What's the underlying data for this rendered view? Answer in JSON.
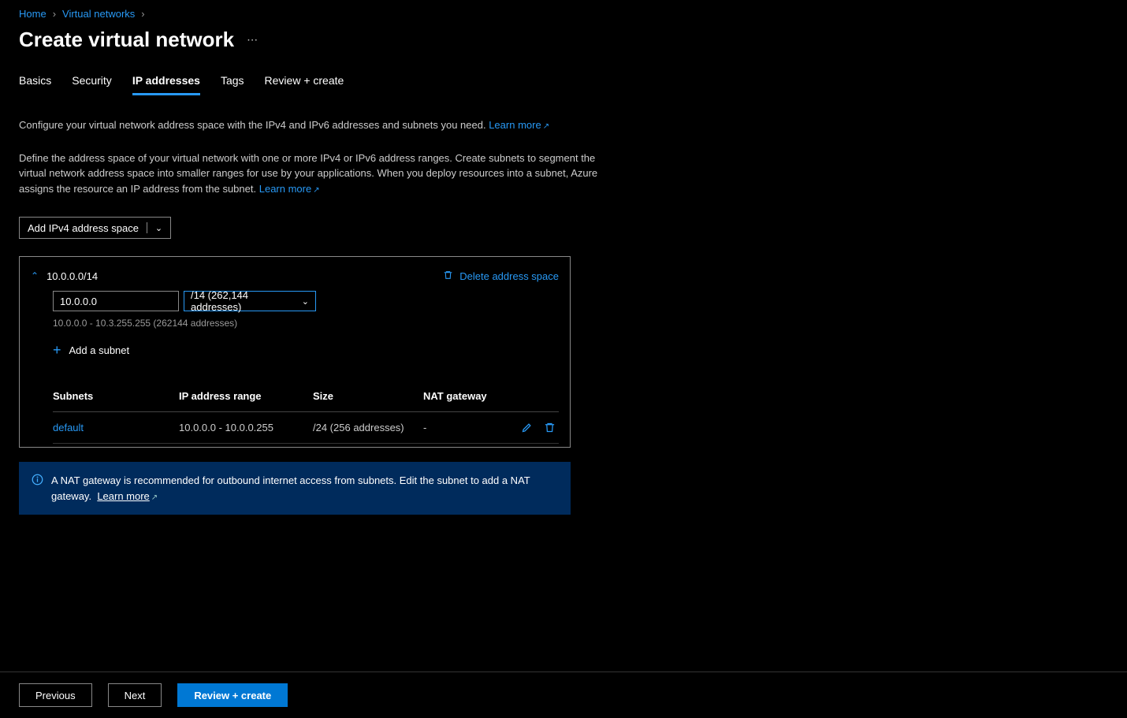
{
  "breadcrumbs": {
    "home": "Home",
    "vnets": "Virtual networks"
  },
  "page_title": "Create virtual network",
  "tabs": {
    "basics": "Basics",
    "security": "Security",
    "ip": "IP addresses",
    "tags": "Tags",
    "review": "Review + create"
  },
  "intro": {
    "line1": "Configure your virtual network address space with the IPv4 and IPv6 addresses and subnets you need.",
    "learn_more": "Learn more",
    "line2": "Define the address space of your virtual network with one or more IPv4 or IPv6 address ranges. Create subnets to segment the virtual network address space into smaller ranges for use by your applications. When you deploy resources into a subnet, Azure assigns the resource an IP address from the subnet."
  },
  "buttons": {
    "add_space": "Add IPv4 address space"
  },
  "space": {
    "title": "10.0.0.0/14",
    "delete_label": "Delete address space",
    "ip_value": "10.0.0.0",
    "cidr_label": "/14 (262,144 addresses)",
    "range_hint": "10.0.0.0 - 10.3.255.255 (262144 addresses)",
    "add_subnet": "Add a subnet",
    "columns": {
      "subnets": "Subnets",
      "range": "IP address range",
      "size": "Size",
      "nat": "NAT gateway"
    },
    "rows": [
      {
        "name": "default",
        "range": "10.0.0.0 - 10.0.0.255",
        "size": "/24 (256 addresses)",
        "nat": "-"
      }
    ]
  },
  "info": {
    "text": "A NAT gateway is recommended for outbound internet access from subnets. Edit the subnet to add a NAT gateway.",
    "learn_more": "Learn more"
  },
  "footer": {
    "previous": "Previous",
    "next": "Next",
    "review": "Review + create"
  }
}
